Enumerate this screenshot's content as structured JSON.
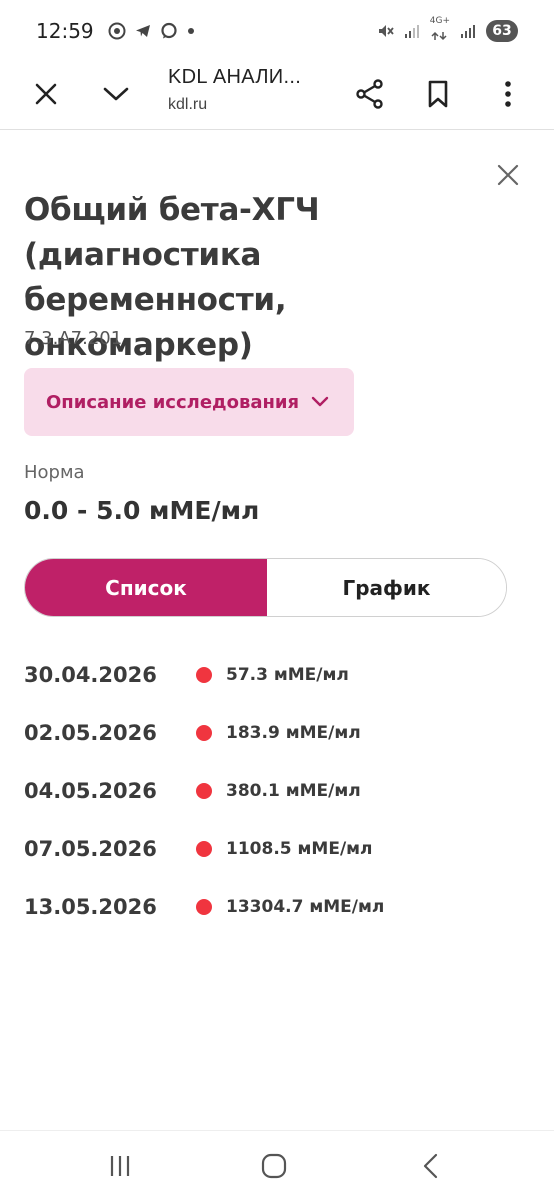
{
  "status_bar": {
    "time": "12:59",
    "network_label": "4G+",
    "battery": "63"
  },
  "browser": {
    "title": "KDL АНАЛИ...",
    "url": "kdl.ru"
  },
  "test": {
    "title": "Общий бета-ХГЧ (диагностика беременности, онкомаркер)",
    "code": "7.3.A7.201",
    "description_label": "Описание исследования",
    "norm_label": "Норма",
    "norm_value": "0.0 - 5.0 мМЕ/мл"
  },
  "tabs": {
    "list": "Список",
    "graph": "График",
    "active": "list"
  },
  "results": [
    {
      "date": "30.04.2026",
      "value": "57.3 мМЕ/мл"
    },
    {
      "date": "02.05.2026",
      "value": "183.9 мМЕ/мл"
    },
    {
      "date": "04.05.2026",
      "value": "380.1 мМЕ/мл"
    },
    {
      "date": "07.05.2026",
      "value": "1108.5 мМЕ/мл"
    },
    {
      "date": "13.05.2026",
      "value": "13304.7 мМЕ/мл"
    }
  ],
  "colors": {
    "accent": "#bf2168",
    "accent_light": "#f8dcea",
    "out_of_range_dot": "#f0353f"
  },
  "icons": {
    "close_tab": "close-icon",
    "collapse": "chevron-down-icon",
    "share": "share-icon",
    "bookmark": "bookmark-icon",
    "menu": "more-vert-icon",
    "dialog_close": "close-icon",
    "nav_recents": "recents-icon",
    "nav_home": "home-icon",
    "nav_back": "back-icon"
  }
}
